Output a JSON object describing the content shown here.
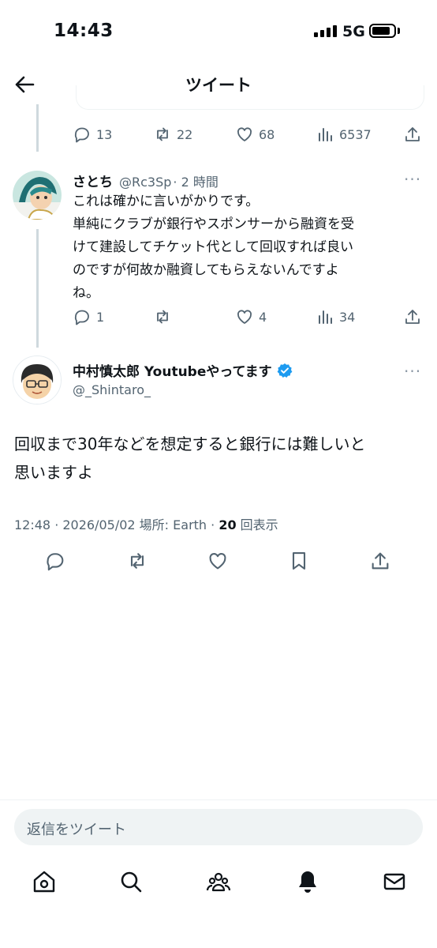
{
  "status_bar": {
    "time": "14:43",
    "network": "5G"
  },
  "header": {
    "title": "ツイート"
  },
  "prev_tweet": {
    "replies": "13",
    "retweets": "22",
    "likes": "68",
    "views": "6537"
  },
  "reply_tweet": {
    "name": "さとち",
    "handle": "@Rc3Sp",
    "time": "· 2 時間",
    "text_lines": [
      "これは確かに言いがかりです。",
      "単純にクラブが銀行やスポンサーから融資を受",
      "けて建設してチケット代として回収すれば良い",
      "のですが何故か融資してもらえないんですよ",
      "ね。"
    ],
    "replies": "1",
    "likes": "4",
    "views": "34"
  },
  "main_tweet": {
    "name": "中村慎太郎 Youtubeやってます",
    "handle": "@_Shintaro_",
    "text_lines": [
      "回収まで30年などを想定すると銀行には難しいと",
      "思いますよ"
    ],
    "meta_prefix": "12:48 · 2026/05/02 場所: Earth · ",
    "view_count": "20",
    "view_label": " 回表示",
    "verified_color": "#1d9bf0"
  },
  "reply_input": {
    "placeholder": "返信をツイート"
  },
  "bottom_nav": [
    "home-icon",
    "search-icon",
    "communities-icon",
    "notifications-icon",
    "messages-icon"
  ]
}
